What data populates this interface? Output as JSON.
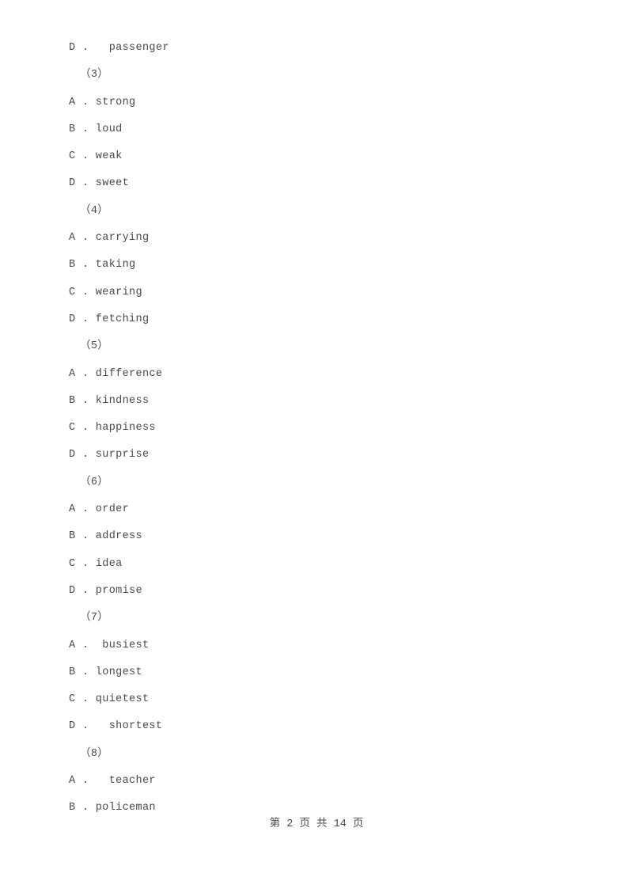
{
  "document": {
    "type": "exam-paper-page",
    "text_color": "#4a4a4a",
    "background_color": "#ffffff"
  },
  "lines": [
    {
      "kind": "option",
      "text": "D .   passenger"
    },
    {
      "kind": "group",
      "text": "（3）"
    },
    {
      "kind": "option",
      "text": "A . strong"
    },
    {
      "kind": "option",
      "text": "B . loud"
    },
    {
      "kind": "option",
      "text": "C . weak"
    },
    {
      "kind": "option",
      "text": "D . sweet"
    },
    {
      "kind": "group",
      "text": "（4）"
    },
    {
      "kind": "option",
      "text": "A . carrying"
    },
    {
      "kind": "option",
      "text": "B . taking"
    },
    {
      "kind": "option",
      "text": "C . wearing"
    },
    {
      "kind": "option",
      "text": "D . fetching"
    },
    {
      "kind": "group",
      "text": "（5）"
    },
    {
      "kind": "option",
      "text": "A . difference"
    },
    {
      "kind": "option",
      "text": "B . kindness"
    },
    {
      "kind": "option",
      "text": "C . happiness"
    },
    {
      "kind": "option",
      "text": "D . surprise"
    },
    {
      "kind": "group",
      "text": "（6）"
    },
    {
      "kind": "option",
      "text": "A . order"
    },
    {
      "kind": "option",
      "text": "B . address"
    },
    {
      "kind": "option",
      "text": "C . idea"
    },
    {
      "kind": "option",
      "text": "D . promise"
    },
    {
      "kind": "group",
      "text": "（7）"
    },
    {
      "kind": "option",
      "text": "A .  busiest"
    },
    {
      "kind": "option",
      "text": "B . longest"
    },
    {
      "kind": "option",
      "text": "C . quietest"
    },
    {
      "kind": "option",
      "text": "D .   shortest"
    },
    {
      "kind": "group",
      "text": "（8）"
    },
    {
      "kind": "option",
      "text": "A .   teacher"
    },
    {
      "kind": "option",
      "text": "B . policeman"
    }
  ],
  "footer": {
    "text": "第 2 页 共 14 页",
    "current_page": "2",
    "total_pages": "14"
  }
}
